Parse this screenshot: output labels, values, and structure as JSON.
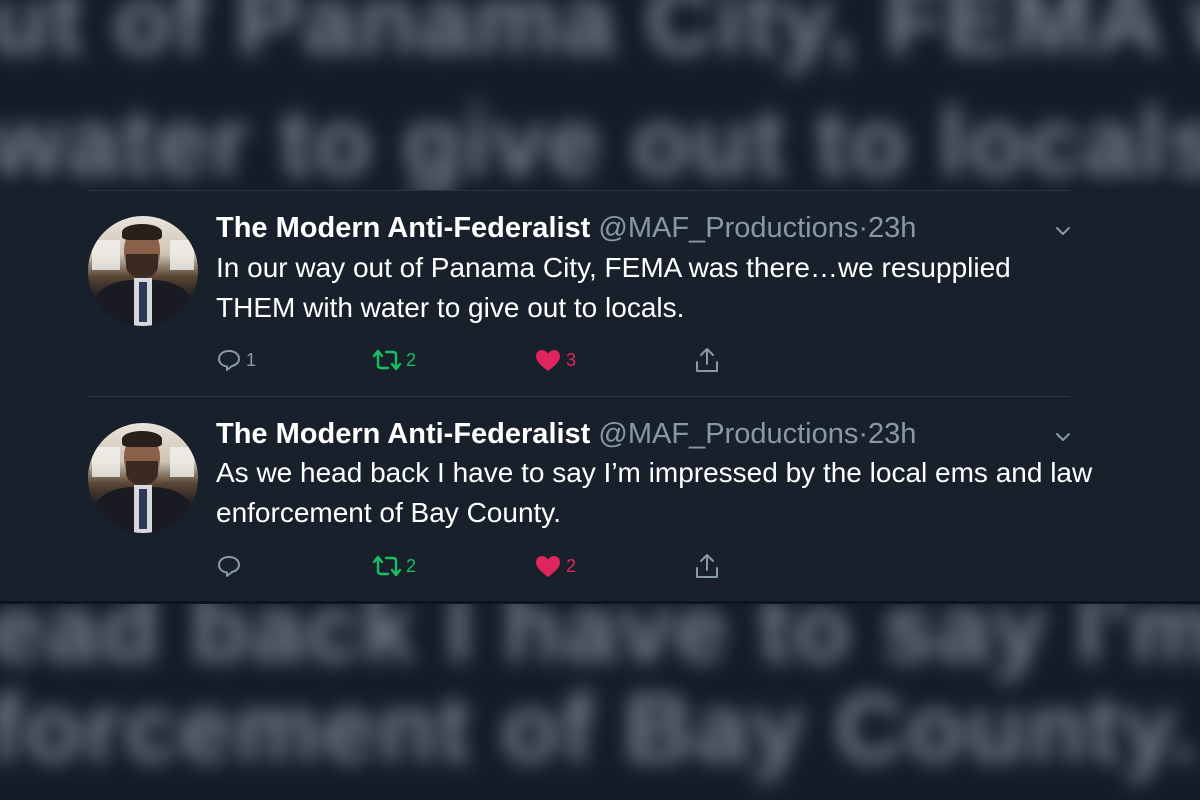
{
  "background": {
    "top_line_1": "ut of Panama City, FEMA was th",
    "top_line_2": "water to give out to locals.",
    "bottom_line_1": "ead back I have to say I'm impres",
    "bottom_line_2": "forcement of Bay County."
  },
  "tweets": [
    {
      "name": "The Modern Anti-Federalist",
      "handle": "@MAF_Productions",
      "separator": "·",
      "time": "23h",
      "text": "In our way out of Panama City, FEMA was there…we resupplied THEM with water to give out to locals.",
      "replies": "1",
      "retweets": "2",
      "likes": "3"
    },
    {
      "name": "The Modern Anti-Federalist",
      "handle": "@MAF_Productions",
      "separator": "·",
      "time": "23h",
      "text": "As we head back I have to say I’m impressed by the local ems and law enforcement of Bay County.",
      "replies": "",
      "retweets": "2",
      "likes": "2"
    }
  ],
  "colors": {
    "background": "#15202b",
    "text": "#ffffff",
    "secondary": "#8899a6",
    "retweet": "#17bf63",
    "like": "#e0245e"
  },
  "icons": [
    "reply-icon",
    "retweet-icon",
    "like-icon",
    "share-icon",
    "chevron-down-icon"
  ]
}
